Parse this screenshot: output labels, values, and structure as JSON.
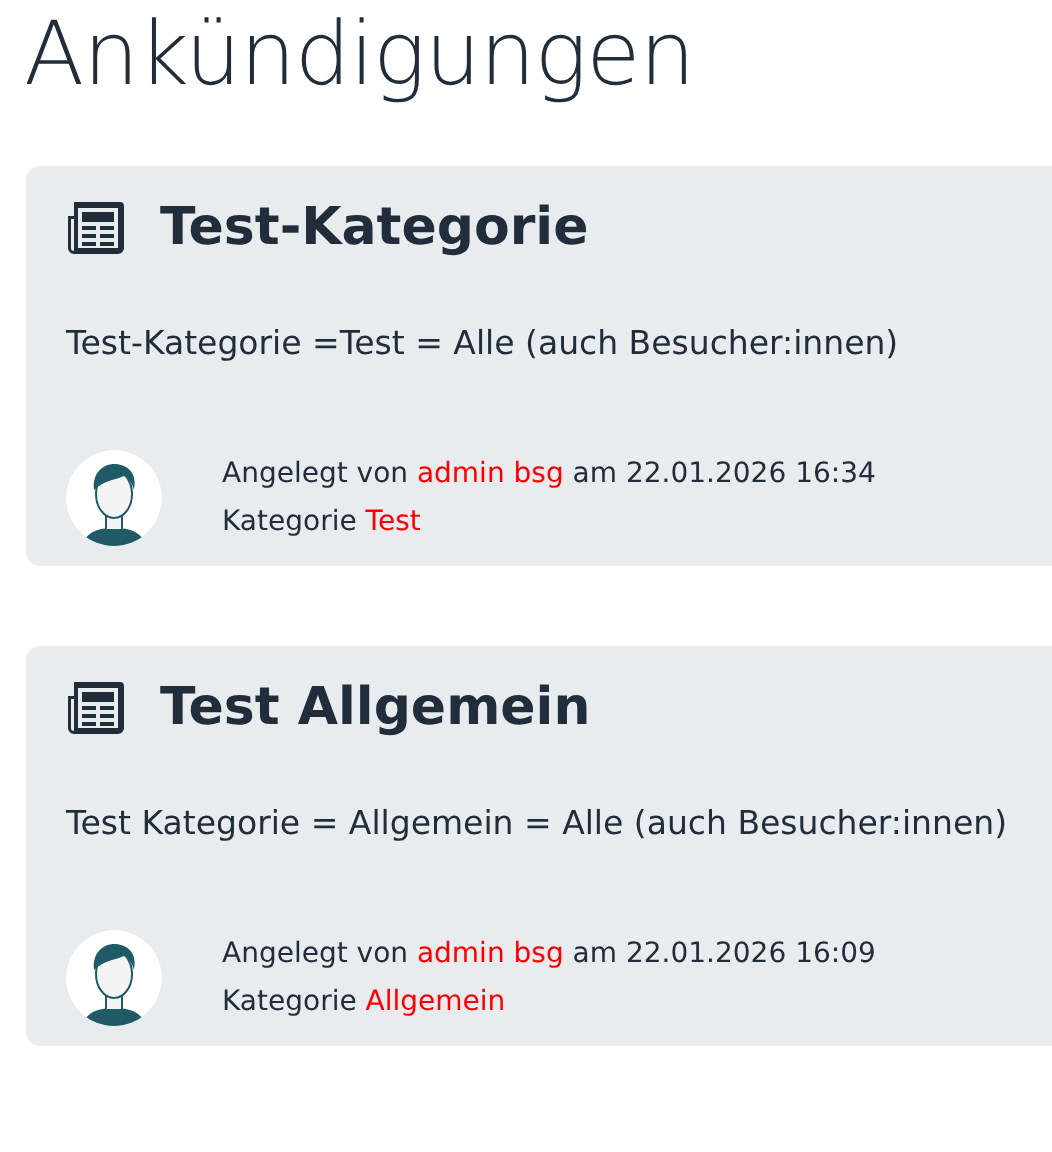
{
  "page_title": "Ankündigungen",
  "announcements": [
    {
      "title": "Test-Kategorie",
      "text": "Test-Kategorie =Test = Alle (auch Besucher:innen)",
      "created_prefix": "Angelegt von",
      "author": "admin bsg",
      "created_suffix": "am 22.01.2026 16:34",
      "category_label": "Kategorie",
      "category": "Test"
    },
    {
      "title": "Test Allgemein",
      "text": "Test Kategorie = Allgemein = Alle (auch Besucher:innen)",
      "created_prefix": "Angelegt von",
      "author": "admin bsg",
      "created_suffix": "am 22.01.2026 16:09",
      "category_label": "Kategorie",
      "category": "Allgemein"
    }
  ]
}
